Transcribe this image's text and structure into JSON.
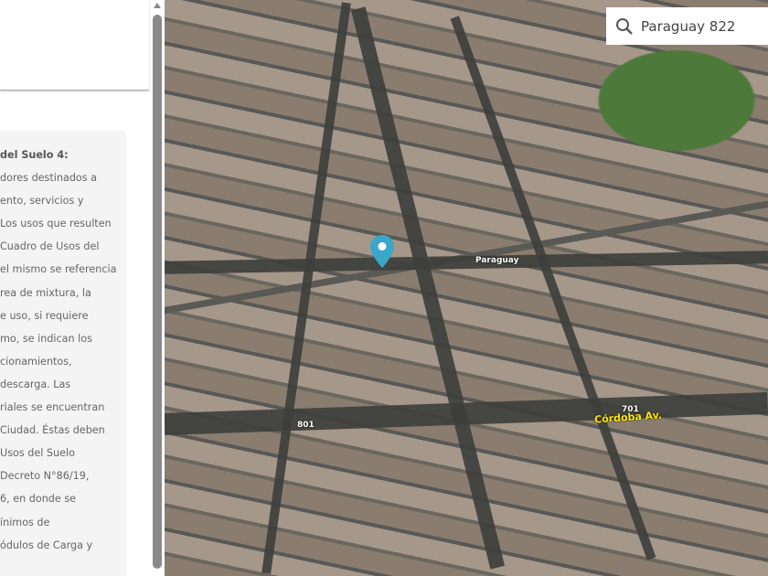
{
  "panel": {
    "lines": [
      "del Suelo 4:",
      "dores destinados a",
      "ento, servicios y",
      "Los usos que resulten",
      "Cuadro de Usos del",
      "el mismo se referencia",
      "rea de mixtura, la",
      "e uso, si requiere",
      "mo, se indican los",
      "cionamientos,",
      "descarga. Las",
      "riales se encuentran",
      "Ciudad. Éstas deben",
      "Usos del Suelo",
      "Decreto N°86/19,",
      "6, en donde se",
      "ínimos de",
      "ódulos de Carga y"
    ]
  },
  "search": {
    "value": "Paraguay 822",
    "icon": "search-icon"
  },
  "map": {
    "labels": {
      "paraguay": "Paraguay",
      "cordoba": "Córdoba Av.",
      "n801": "801",
      "n701": "701"
    },
    "pin_color": "#3aa6c9"
  }
}
